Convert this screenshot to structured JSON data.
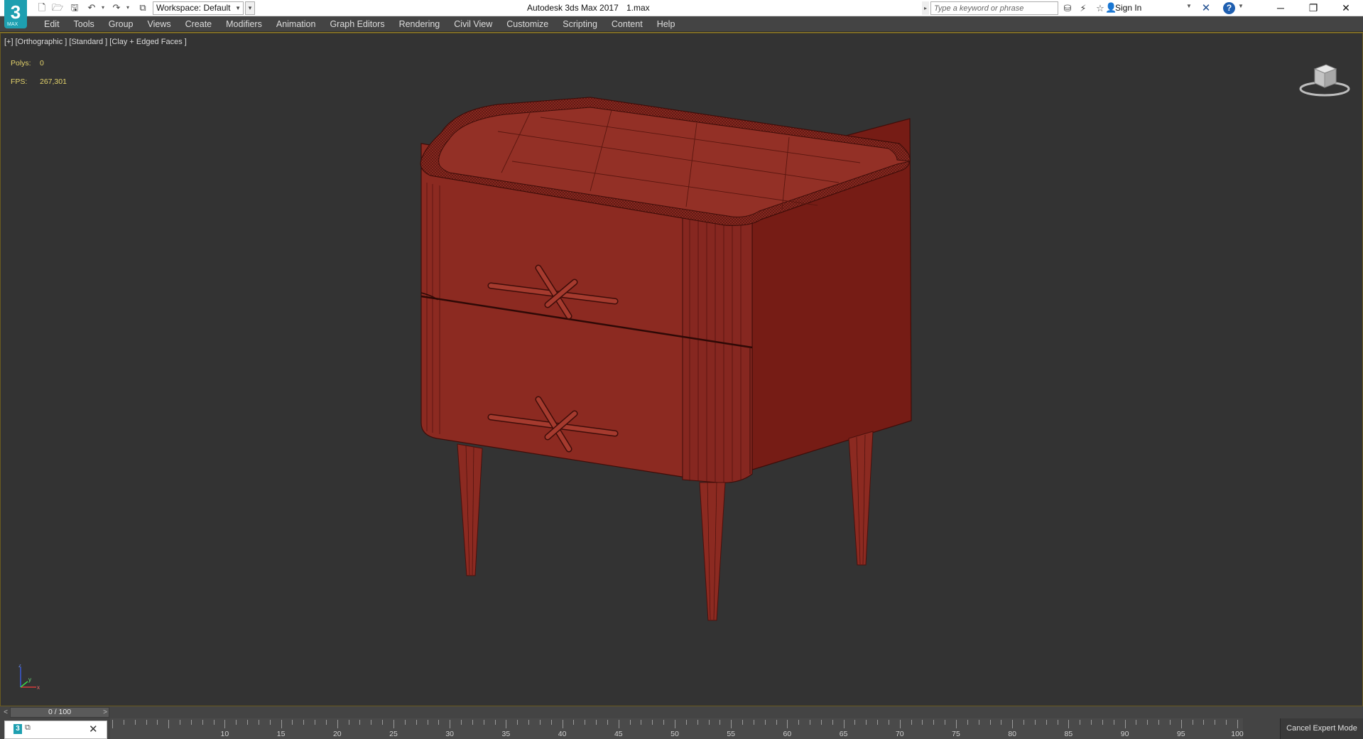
{
  "title_bar": {
    "app_logo_text": "3",
    "app_logo_sub": "MAX",
    "workspace_label": "Workspace: Default",
    "window_title": "Autodesk 3ds Max 2017",
    "file_name": "1.max",
    "search_placeholder": "Type a keyword or phrase",
    "sign_in_label": "Sign In",
    "icons": [
      "new-file-icon",
      "open-file-icon",
      "save-icon",
      "undo-icon",
      "redo-icon",
      "project-folder-icon",
      "binoculars-icon",
      "satellite-icon",
      "star-icon",
      "user-icon",
      "exchange-icon",
      "help-icon"
    ],
    "window_controls": {
      "minimize": "─",
      "restore": "❐",
      "close": "✕"
    }
  },
  "menu": {
    "items": [
      "Edit",
      "Tools",
      "Group",
      "Views",
      "Create",
      "Modifiers",
      "Animation",
      "Graph Editors",
      "Rendering",
      "Civil View",
      "Customize",
      "Scripting",
      "Content",
      "Help"
    ]
  },
  "viewport": {
    "label": "[+] [Orthographic ] [Standard ] [Clay + Edged Faces ]",
    "stats": {
      "polys_label": "Polys:",
      "polys_value": "0",
      "fps_label": "FPS:",
      "fps_value": "267,301"
    },
    "model_color": "#8c2a21",
    "wire_color": "#4a100c",
    "axes": {
      "x": "x",
      "y": "y",
      "z": "z"
    }
  },
  "timeline": {
    "frame_display": "0 / 100",
    "prev_label": "<",
    "next_label": ">",
    "ruler_labels": [
      "10",
      "15",
      "20",
      "25",
      "30",
      "35",
      "40",
      "45",
      "50",
      "55",
      "60",
      "65",
      "70",
      "75",
      "80",
      "85",
      "90",
      "95",
      "100"
    ]
  },
  "status": {
    "cancel_expert_mode": "Cancel Expert Mode"
  }
}
